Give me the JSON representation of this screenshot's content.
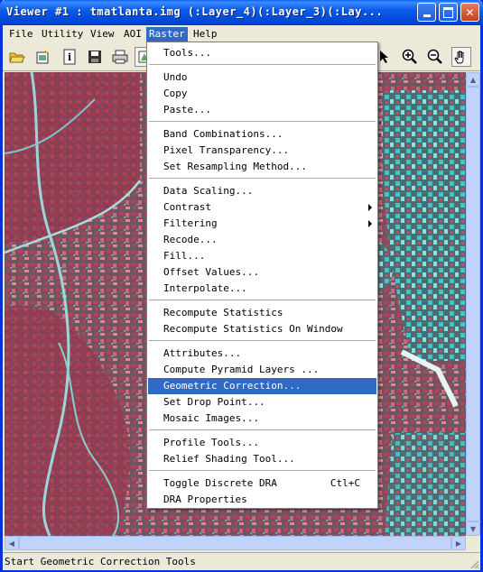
{
  "window": {
    "title": "Viewer #1 : tmatlanta.img (:Layer_4)(:Layer_3)(:Lay..."
  },
  "menubar": [
    {
      "label": "File"
    },
    {
      "label": "Utility"
    },
    {
      "label": "View"
    },
    {
      "label": "AOI"
    },
    {
      "label": "Raster",
      "active": true
    },
    {
      "label": "Help"
    }
  ],
  "toolbar": {
    "icons": [
      "open-folder-icon",
      "new-file-icon",
      "info-icon",
      "save-icon",
      "print-icon",
      "overlay-icon",
      "arrow-cursor-icon",
      "zoom-in-icon",
      "zoom-out-icon",
      "pan-hand-icon"
    ]
  },
  "raster_menu": {
    "tools": "Tools...",
    "undo": "Undo",
    "copy": "Copy",
    "paste": "Paste...",
    "band_combinations": "Band Combinations...",
    "pixel_transparency": "Pixel Transparency...",
    "set_resampling": "Set Resampling Method...",
    "data_scaling": "Data Scaling...",
    "contrast": "Contrast",
    "filtering": "Filtering",
    "recode": "Recode...",
    "fill": "Fill...",
    "offset_values": "Offset Values...",
    "interpolate": "Interpolate...",
    "recompute_statistics": "Recompute Statistics",
    "recompute_statistics_window": "Recompute Statistics On Window",
    "attributes": "Attributes...",
    "compute_pyramid": "Compute Pyramid Layers ...",
    "geometric_correction": "Geometric Correction...",
    "set_drop_point": "Set Drop Point...",
    "mosaic_images": "Mosaic Images...",
    "profile_tools": "Profile Tools...",
    "relief_shading": "Relief Shading Tool...",
    "toggle_discrete_dra": "Toggle Discrete DRA",
    "toggle_discrete_dra_shortcut": "Ctl+C",
    "dra_properties": "DRA Properties",
    "highlighted": "geometric_correction"
  },
  "status": {
    "text": "Start Geometric Correction Tools"
  },
  "colors": {
    "titlebar": "#0054e3",
    "menu_highlight": "#316ac5",
    "image_red": "#b8405a",
    "image_cyan": "#3fc6c8"
  }
}
